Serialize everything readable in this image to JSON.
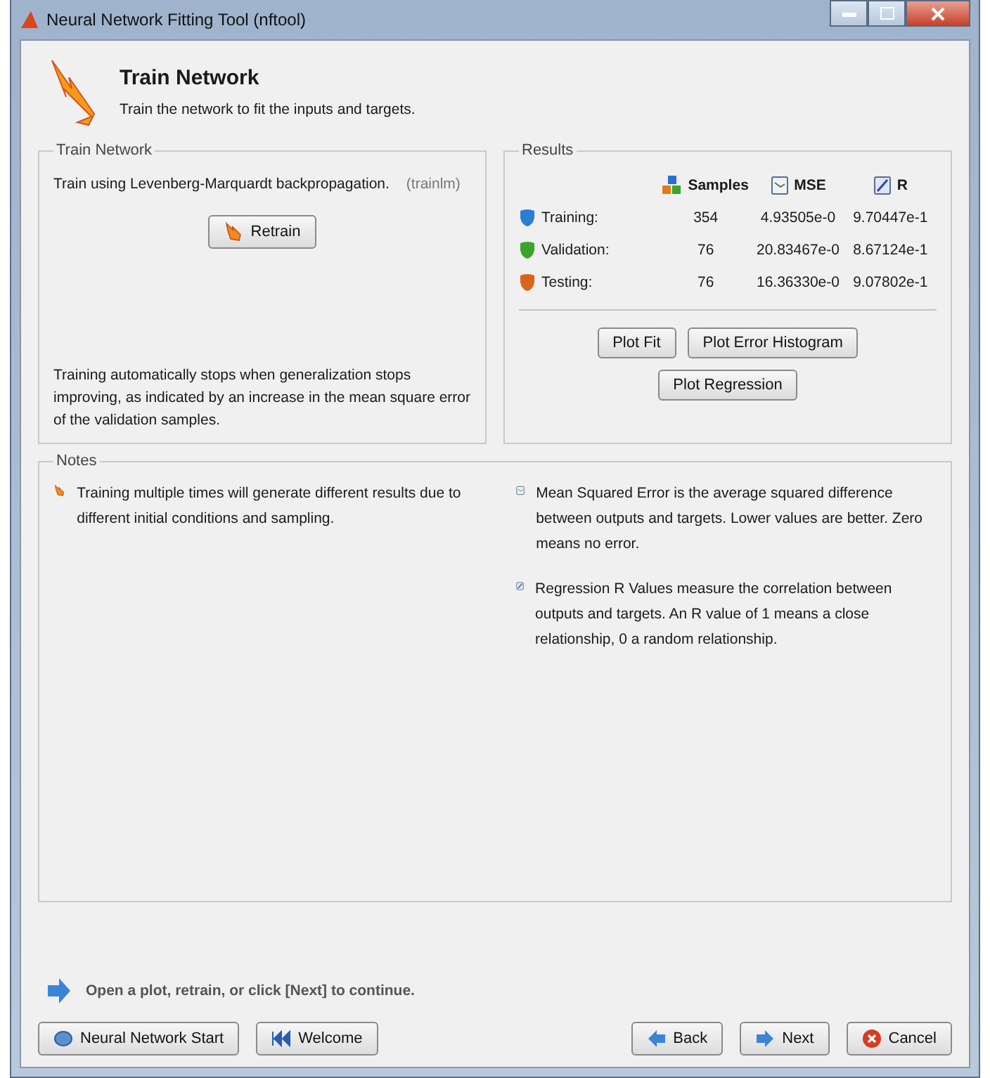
{
  "window": {
    "title": "Neural Network Fitting Tool (nftool)"
  },
  "header": {
    "title": "Train Network",
    "subtitle": "Train the network to fit the inputs and targets."
  },
  "train_panel": {
    "legend": "Train Network",
    "algorithm": "Train using Levenberg-Marquardt backpropagation.",
    "function": "(trainlm)",
    "retrain_button": "Retrain",
    "note": "Training automatically stops when generalization stops improving, as indicated by an increase in the mean square error of the validation samples."
  },
  "results": {
    "legend": "Results",
    "columns": [
      "Samples",
      "MSE",
      "R"
    ],
    "rows": [
      {
        "label": "Training:",
        "color": "#2a7fd4",
        "samples": "354",
        "mse": "4.93505e-0",
        "r": "9.70447e-1"
      },
      {
        "label": "Validation:",
        "color": "#3aa52a",
        "samples": "76",
        "mse": "20.83467e-0",
        "r": "8.67124e-1"
      },
      {
        "label": "Testing:",
        "color": "#d8651a",
        "samples": "76",
        "mse": "16.36330e-0",
        "r": "9.07802e-1"
      }
    ],
    "buttons": [
      "Plot Fit",
      "Plot Error Histogram",
      "Plot Regression"
    ]
  },
  "notes": {
    "legend": "Notes",
    "items": [
      {
        "kind": "train",
        "text": "Training multiple times will generate different results due to different initial conditions and sampling."
      },
      {
        "kind": "mse",
        "text": "Mean Squared Error is the average squared difference between outputs and targets. Lower values are better. Zero means no error."
      },
      {
        "kind": "regression",
        "text": "Regression R Values measure the correlation between outputs and targets. An R value of 1 means a close relationship, 0 a random relationship."
      }
    ]
  },
  "hint": "Open a plot, retrain, or click [Next] to continue.",
  "footer": {
    "left_buttons": [
      {
        "kind": "start",
        "label": "Neural Network Start"
      },
      {
        "kind": "welcome",
        "label": "Welcome"
      }
    ],
    "right_buttons": [
      {
        "kind": "back",
        "label": "Back"
      },
      {
        "kind": "next",
        "label": "Next"
      },
      {
        "kind": "cancel",
        "label": "Cancel"
      }
    ]
  }
}
